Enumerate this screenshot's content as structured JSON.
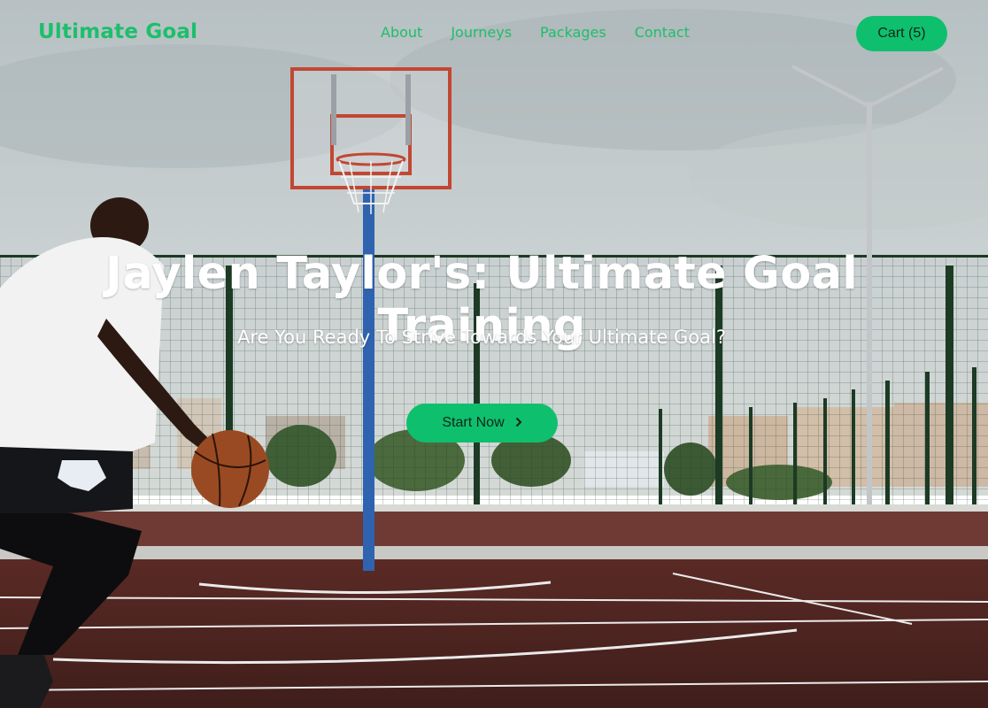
{
  "brand": "Ultimate Goal",
  "nav": {
    "items": [
      {
        "label": "About"
      },
      {
        "label": "Journeys"
      },
      {
        "label": "Packages"
      },
      {
        "label": "Contact"
      }
    ],
    "cart_label": "Cart (5)"
  },
  "hero": {
    "title": "Jaylen Taylor's: Ultimate Goal Training",
    "subtitle": "Are You Ready To Strive Towards Your Ultimate Goal?",
    "cta_label": "Start Now",
    "cta_icon": "chevron-right-icon"
  },
  "colors": {
    "accent": "#1cbf6b",
    "button": "#0ec06d",
    "title": "#ffffff"
  }
}
